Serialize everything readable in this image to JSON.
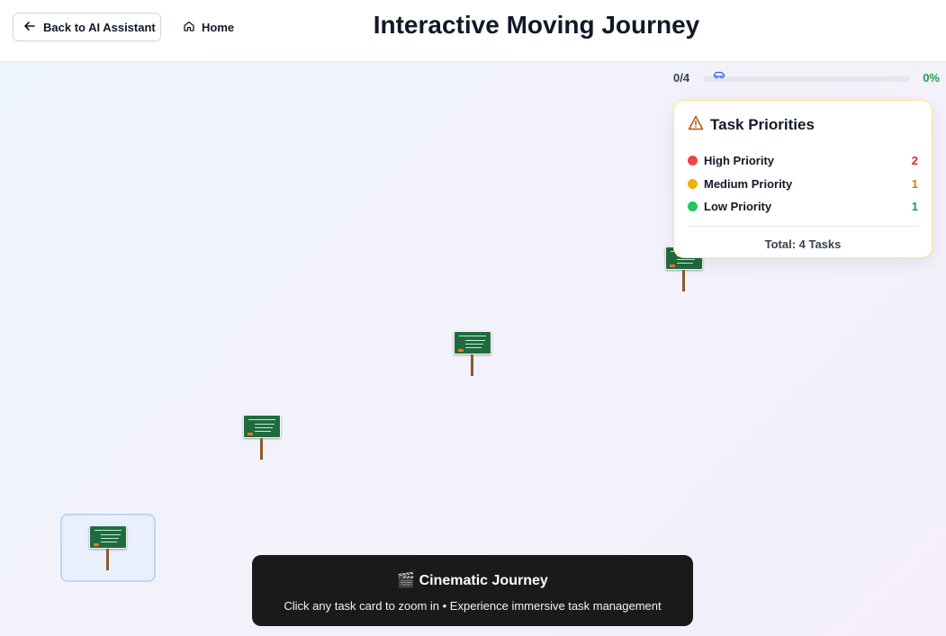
{
  "header": {
    "back_label": "Back to AI Assistant",
    "home_label": "Home",
    "title": "Interactive Moving Journey"
  },
  "progress": {
    "completed_text": "0/4",
    "percent_text": "0%",
    "fraction": 0
  },
  "priorities": {
    "title": "Task Priorities",
    "items": [
      {
        "label": "High Priority",
        "count": "2",
        "color": "#dc2626"
      },
      {
        "label": "Medium Priority",
        "count": "1",
        "color": "#d97706"
      },
      {
        "label": "Low Priority",
        "count": "1",
        "color": "#16a34a"
      }
    ],
    "total": "Total: 4 Tasks"
  },
  "banner": {
    "title": "🎬 Cinematic Journey",
    "subtitle": "Click any task card to zoom in • Experience immersive task management"
  },
  "colors": {
    "sign_board": "#1f6b3f",
    "sign_pole": "#8b5a2b",
    "progress_car": "#2563eb",
    "card_border": "#fde68a"
  },
  "icons": {
    "back": "arrow-left-icon",
    "home": "home-icon",
    "warning": "warning-triangle-icon",
    "car": "car-icon"
  }
}
